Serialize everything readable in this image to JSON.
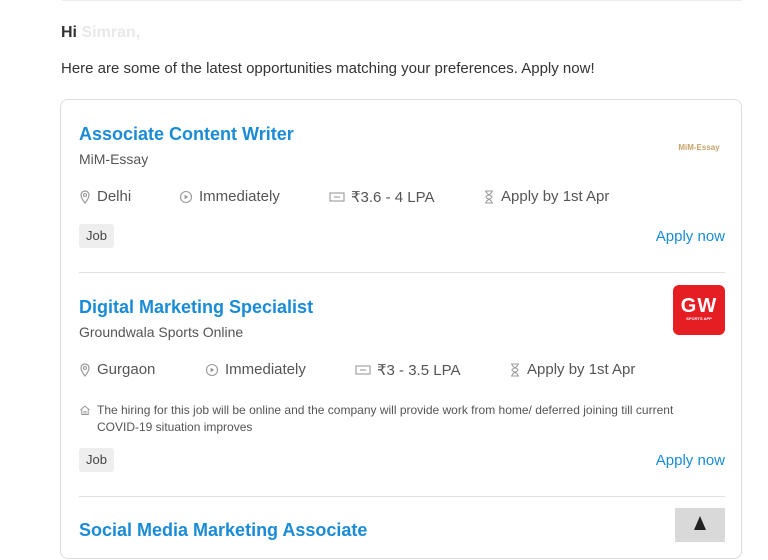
{
  "greeting": {
    "prefix": "Hi",
    "name": "Simran,"
  },
  "intro": "Here are some of the latest opportunities matching your preferences. Apply now!",
  "jobs": [
    {
      "title": "Associate Content Writer",
      "company": "MiM-Essay",
      "logo_text": "MiM-Essay",
      "location": "Delhi",
      "start": "Immediately",
      "salary": "₹3.6 - 4 LPA",
      "deadline": "Apply by 1st Apr",
      "type": "Job",
      "apply_label": "Apply now"
    },
    {
      "title": "Digital Marketing Specialist",
      "company": "Groundwala Sports Online",
      "logo_text": "GW",
      "logo_subtext": "SPORTS APP",
      "location": "Gurgaon",
      "start": "Immediately",
      "salary": "₹3 - 3.5 LPA",
      "deadline": "Apply by 1st Apr",
      "note": "The hiring for this job will be online and the company will provide work from home/ deferred joining till current COVID-19 situation improves",
      "type": "Job",
      "apply_label": "Apply now"
    },
    {
      "title": "Social Media Marketing Associate"
    }
  ],
  "colors": {
    "link": "#1a8bd6",
    "gw_brand": "#e51e24",
    "badge_bg": "#eeeeee"
  },
  "icons": {
    "location": "location-pin-icon",
    "start": "play-circle-icon",
    "salary": "money-icon",
    "deadline": "hourglass-icon",
    "note": "home-icon"
  }
}
